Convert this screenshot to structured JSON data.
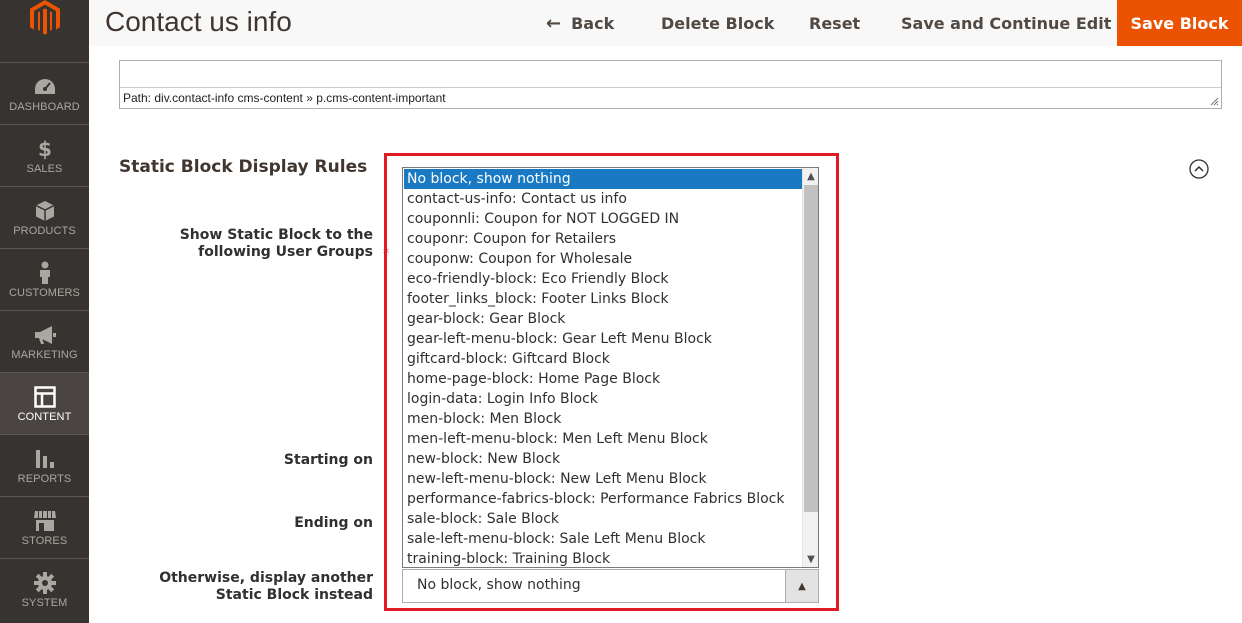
{
  "sidebar": {
    "items": [
      {
        "label": "DASHBOARD",
        "icon": "dashboard-icon"
      },
      {
        "label": "SALES",
        "icon": "dollar-icon"
      },
      {
        "label": "PRODUCTS",
        "icon": "box-icon"
      },
      {
        "label": "CUSTOMERS",
        "icon": "person-icon"
      },
      {
        "label": "MARKETING",
        "icon": "megaphone-icon"
      },
      {
        "label": "CONTENT",
        "icon": "layout-icon",
        "active": true
      },
      {
        "label": "REPORTS",
        "icon": "bar-chart-icon"
      },
      {
        "label": "STORES",
        "icon": "store-icon"
      },
      {
        "label": "SYSTEM",
        "icon": "gear-icon"
      }
    ]
  },
  "header": {
    "title": "Contact us info",
    "back_label": "Back",
    "delete_label": "Delete Block",
    "reset_label": "Reset",
    "save_continue_label": "Save and Continue Edit",
    "save_label": "Save Block"
  },
  "editor": {
    "path": "Path: div.contact-info cms-content » p.cms-content-important"
  },
  "section": {
    "title": "Static Block Display Rules",
    "fields": {
      "groups_label": "Show Static Block to the following User Groups",
      "required_mark": "*",
      "starting_label": "Starting on",
      "ending_label": "Ending on",
      "otherwise_label": "Otherwise, display another Static Block instead"
    },
    "listbox_options": [
      "No block, show nothing",
      "contact-us-info: Contact us info",
      "couponnli: Coupon for NOT LOGGED IN",
      "couponr: Coupon for Retailers",
      "couponw: Coupon for Wholesale",
      "eco-friendly-block: Eco Friendly Block",
      "footer_links_block: Footer Links Block",
      "gear-block: Gear Block",
      "gear-left-menu-block: Gear Left Menu Block",
      "giftcard-block: Giftcard Block",
      "home-page-block: Home Page Block",
      "login-data: Login Info Block",
      "men-block: Men Block",
      "men-left-menu-block: Men Left Menu Block",
      "new-block: New Block",
      "new-left-menu-block: New Left Menu Block",
      "performance-fabrics-block: Performance Fabrics Block",
      "sale-block: Sale Block",
      "sale-left-menu-block: Sale Left Menu Block",
      "training-block: Training Block"
    ],
    "selected_option": "No block, show nothing",
    "select_value": "No block, show nothing"
  },
  "colors": {
    "sidebar": "#373330",
    "accent": "#eb5202",
    "selection": "#1979c3",
    "highlight": "#e01b24"
  }
}
